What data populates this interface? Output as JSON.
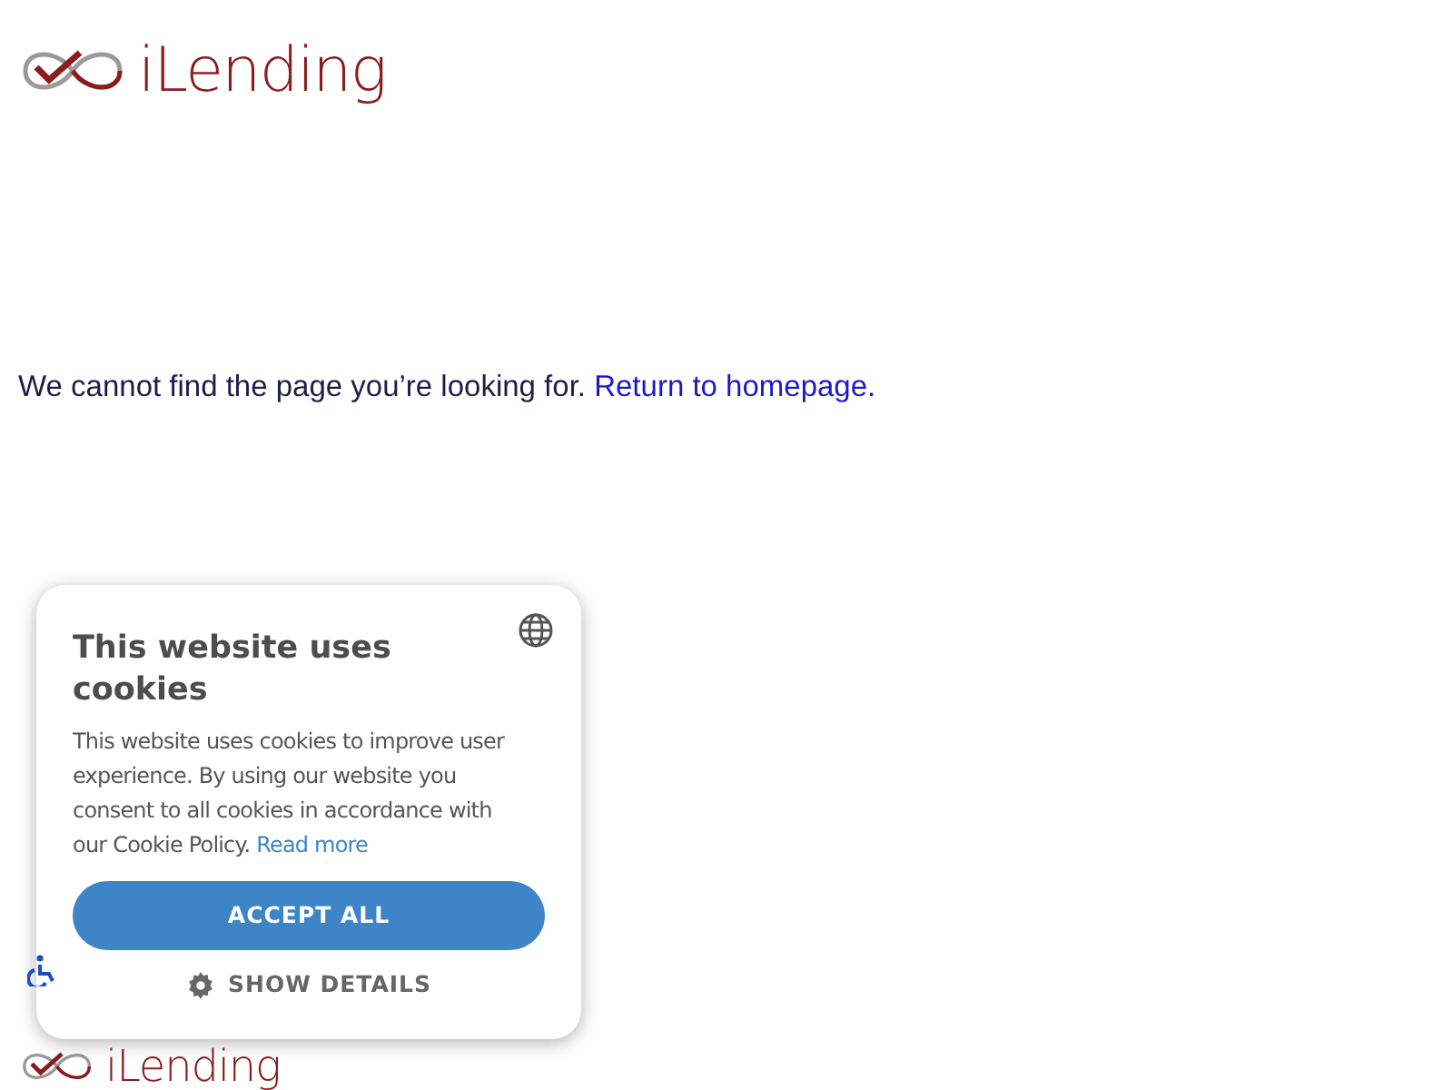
{
  "header": {
    "logo_text": "iLending"
  },
  "message": {
    "text": "We cannot find the page you’re looking for.",
    "link": "Return to homepage."
  },
  "footer": {
    "logo_text": "iLending"
  },
  "cookie_banner": {
    "title": "This website uses cookies",
    "body": "This website uses cookies to improve user experience. By using our website you consent to all cookies in accordance with our Cookie Policy.",
    "link": "Read more",
    "buttons": [
      {
        "kind": "primary",
        "label": "ACCEPT ALL"
      },
      {
        "kind": "details",
        "label": "SHOW DETAILS"
      }
    ]
  }
}
